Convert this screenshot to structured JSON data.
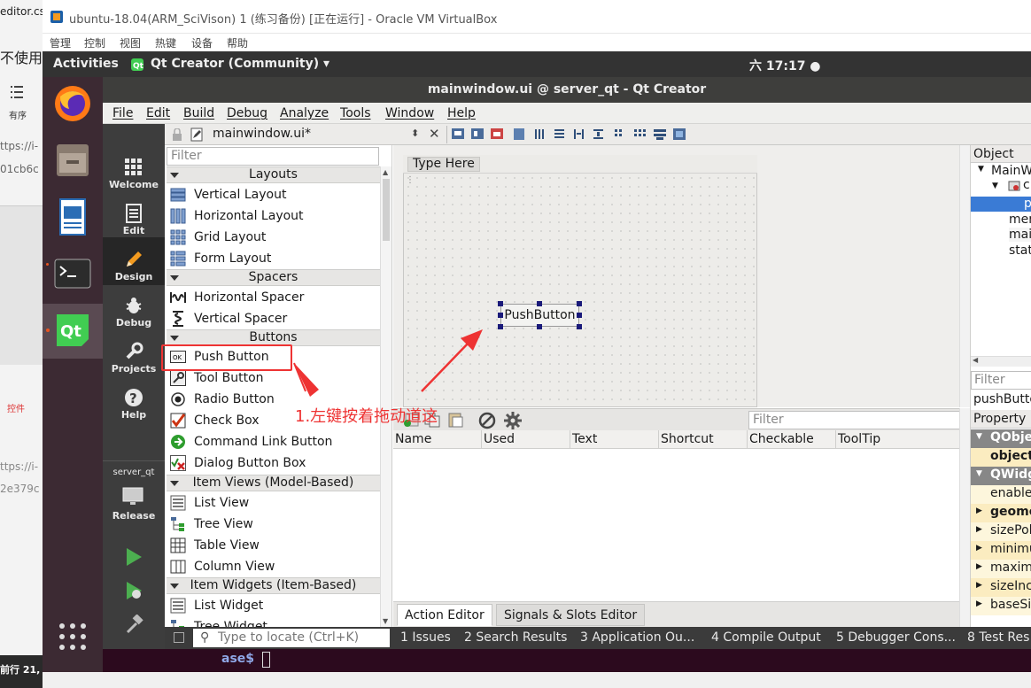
{
  "host": {
    "texts": [
      "editor.cs",
      "不使用",
      "有序",
      "ttps://i-",
      "01cb6c",
      "控件",
      "ttps://i-",
      "2e379c",
      "前行 21,"
    ]
  },
  "virtualbox": {
    "title": "ubuntu-18.04(ARM_SciVison) 1 (练习备份) [正在运行] - Oracle VM VirtualBox",
    "menu": [
      "管理",
      "控制",
      "视图",
      "热键",
      "设备",
      "帮助"
    ]
  },
  "topbar": {
    "activities": "Activities",
    "app": "Qt Creator (Community) ▾",
    "clock": "六 17:17 ●"
  },
  "qt": {
    "title": "mainwindow.ui @ server_qt - Qt Creator",
    "menu": [
      "File",
      "Edit",
      "Build",
      "Debug",
      "Analyze",
      "Tools",
      "Window",
      "Help"
    ],
    "modes": [
      "Welcome",
      "Edit",
      "Design",
      "Debug",
      "Projects",
      "Help"
    ],
    "project": "server_qt",
    "build_config": "Release",
    "editor_tab": "mainwindow.ui*",
    "widget_filter": "Filter",
    "categories": [
      {
        "label": "Layouts",
        "items": [
          "Vertical Layout",
          "Horizontal Layout",
          "Grid Layout",
          "Form Layout"
        ]
      },
      {
        "label": "Spacers",
        "items": [
          "Horizontal Spacer",
          "Vertical Spacer"
        ]
      },
      {
        "label": "Buttons",
        "items": [
          "Push Button",
          "Tool Button",
          "Radio Button",
          "Check Box",
          "Command Link Button",
          "Dialog Button Box"
        ]
      },
      {
        "label": "Item Views (Model-Based)",
        "items": [
          "List View",
          "Tree View",
          "Table View",
          "Column View"
        ]
      },
      {
        "label": "Item Widgets (Item-Based)",
        "items": [
          "List Widget",
          "Tree Widget"
        ]
      }
    ],
    "form": {
      "type_here": "Type Here",
      "push_button": "PushButton"
    },
    "annotation": "1.左键按着拖动道这",
    "action_editor": {
      "filter": "Filter",
      "columns": [
        "Name",
        "Used",
        "Text",
        "Shortcut",
        "Checkable",
        "ToolTip"
      ],
      "tabs": [
        "Action Editor",
        "Signals & Slots Editor"
      ]
    },
    "object_inspector": {
      "header": "Object",
      "items": [
        "MainW",
        "c",
        "p",
        "mer",
        "mai",
        "stat"
      ]
    },
    "property_editor": {
      "filter": "Filter",
      "object": "pushButto",
      "header": "Property",
      "rows": [
        {
          "label": "QObje",
          "type": "section"
        },
        {
          "label": "object",
          "type": "bold"
        },
        {
          "label": "QWidg",
          "type": "section"
        },
        {
          "label": "enable",
          "type": "normal"
        },
        {
          "label": "geome",
          "type": "boldarrow"
        },
        {
          "label": "sizePol",
          "type": "arrow"
        },
        {
          "label": "minimu",
          "type": "arrow"
        },
        {
          "label": "maxim",
          "type": "arrow"
        },
        {
          "label": "sizeInc",
          "type": "arrow"
        },
        {
          "label": "baseSiz",
          "type": "arrow"
        }
      ]
    },
    "locate_placeholder": "Type to locate (Ctrl+K)",
    "output_panes": [
      "1 Issues",
      "2 Search Results",
      "3 Application Ou...",
      "4 Compile Output",
      "5 Debugger Cons...",
      "8 Test Res"
    ],
    "terminal_text": "ase$"
  },
  "colors": {
    "accent_red": "#e33333",
    "dock_bg": "#3c2a33",
    "selection": "#3a7bd5"
  }
}
